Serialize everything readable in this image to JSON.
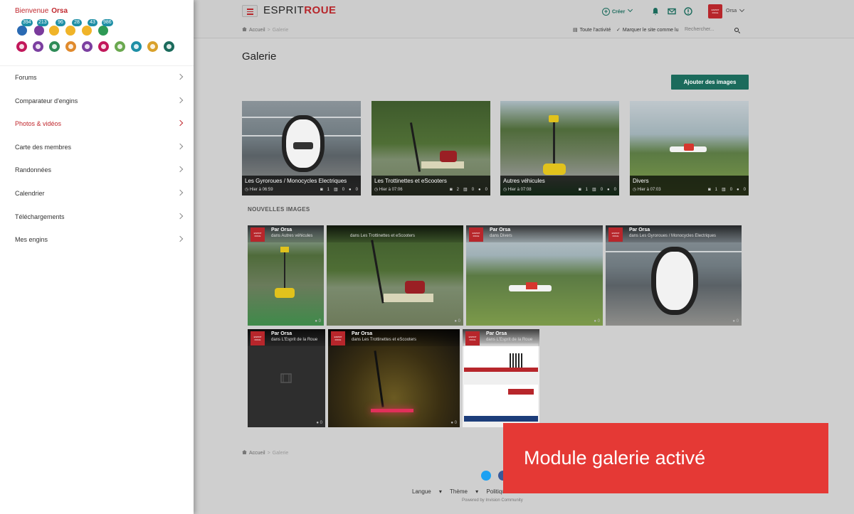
{
  "colors": {
    "brand_red": "#b7262b",
    "accent_teal": "#1b6b5c",
    "overlay_red": "#e53935"
  },
  "sidebar": {
    "welcome": "Bienvenue",
    "username": "Orsa",
    "reputation": [
      {
        "icon": "heart-reaction-icon",
        "count": "394"
      },
      {
        "icon": "trophy-reaction-icon",
        "count": "213"
      },
      {
        "icon": "laugh-reaction-icon",
        "count": "96"
      },
      {
        "icon": "wow-reaction-icon",
        "count": "28"
      },
      {
        "icon": "confused-reaction-icon",
        "count": "43"
      },
      {
        "icon": "thumbs-up-reaction-icon",
        "count": "986"
      }
    ],
    "badges": [
      "badge-heart-icon",
      "badge-star-icon",
      "badge-share-icon",
      "badge-person-icon",
      "badge-ring-icon",
      "badge-chat-icon",
      "badge-upload-icon",
      "badge-list-icon",
      "badge-gift-icon",
      "badge-check-icon"
    ],
    "menu": [
      {
        "label": "Forums"
      },
      {
        "label": "Comparateur d'engins"
      },
      {
        "label": "Photos & vidéos",
        "active": true
      },
      {
        "label": "Carte des membres"
      },
      {
        "label": "Randonnées"
      },
      {
        "label": "Calendrier"
      },
      {
        "label": "Téléchargements"
      },
      {
        "label": "Mes engins"
      }
    ]
  },
  "header": {
    "logo_part1": "ESPRIT",
    "logo_part2": "ROUE",
    "create_label": "Créer",
    "user_name": "Orsa",
    "avatar_text": "ESPRIT ROUE",
    "breadcrumb": [
      "Accueil",
      "Galerie"
    ],
    "activity_all": "Toute l'activité",
    "mark_read": "Marquer le site comme lu",
    "search_placeholder": "Rechercher..."
  },
  "main": {
    "title": "Galerie",
    "add_button": "Ajouter des images",
    "section_new_images": "NOUVELLES IMAGES",
    "albums": [
      {
        "name": "Les Gyroroues / Monocycles Electriques",
        "time": "Hier à 06:59",
        "images": "1",
        "albums": "0",
        "comments": "0"
      },
      {
        "name": "Les Trottinettes et eScooters",
        "time": "Hier à 07:06",
        "images": "2",
        "albums": "0",
        "comments": "0"
      },
      {
        "name": "Autres véhicules",
        "time": "Hier à 07:08",
        "images": "1",
        "albums": "0",
        "comments": "0"
      },
      {
        "name": "Divers",
        "time": "Hier à 07:03",
        "images": "1",
        "albums": "0",
        "comments": "0"
      }
    ],
    "tiles": [
      {
        "by": "Par Orsa",
        "in": "dans Autres véhicules",
        "comments": "0"
      },
      {
        "by": "",
        "in": "",
        "comments": "0"
      },
      {
        "by": "Par Orsa",
        "in": "dans Divers",
        "comments": "0"
      },
      {
        "by": "Par Orsa",
        "in": "dans Les Gyroroues / Monocycles Electriques",
        "comments": "0"
      },
      {
        "by": "Par Orsa",
        "in": "dans L'Esprit de la Roue",
        "comments": "0"
      },
      {
        "by": "Par Orsa",
        "in": "dans Les Trottinettes et eScooters",
        "comments": "0"
      },
      {
        "by": "Par Orsa",
        "in": "dans L'Esprit de la Roue",
        "comments": ""
      }
    ],
    "tile_header_partial_in": "dans Les Trottinettes et eScooters",
    "breadcrumb_footer": [
      "Accueil",
      "Galerie"
    ],
    "footer_links": [
      "Langue",
      "Thème",
      "Politique de c"
    ],
    "powered_by": "Powered by Invision Community"
  },
  "overlay_caption": "Module galerie activé"
}
